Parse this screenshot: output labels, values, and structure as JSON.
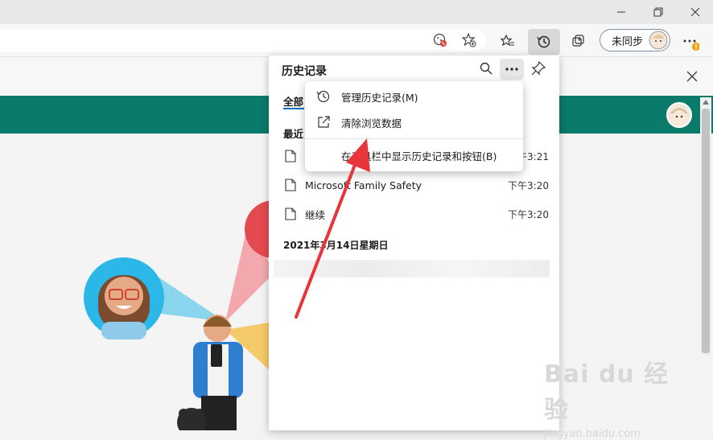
{
  "browser": {
    "sync_label": "未同步",
    "window_controls": {
      "minimize": "minimize-icon",
      "restore": "restore-icon",
      "close": "close-icon"
    }
  },
  "history_panel": {
    "title": "历史记录",
    "tab_all": "全部",
    "section_recent": "最近",
    "items": [
      {
        "title": "",
        "time": "下午3:21"
      },
      {
        "title": "Microsoft Family Safety",
        "time": "下午3:20"
      },
      {
        "title": "继续",
        "time": "下午3:20"
      }
    ],
    "date_header": "2021年3月14日星期日"
  },
  "menu": {
    "manage": "管理历史记录(M)",
    "clear": "清除浏览数据",
    "show_toolbar": "在工具栏中显示历史记录和按钮(B)"
  },
  "watermark": {
    "brand": "Bai du 经验",
    "url": "jingyan.baidu.com"
  },
  "colors": {
    "accent_green": "#0a7a6a",
    "annotation_arrow": "#e8343b"
  }
}
